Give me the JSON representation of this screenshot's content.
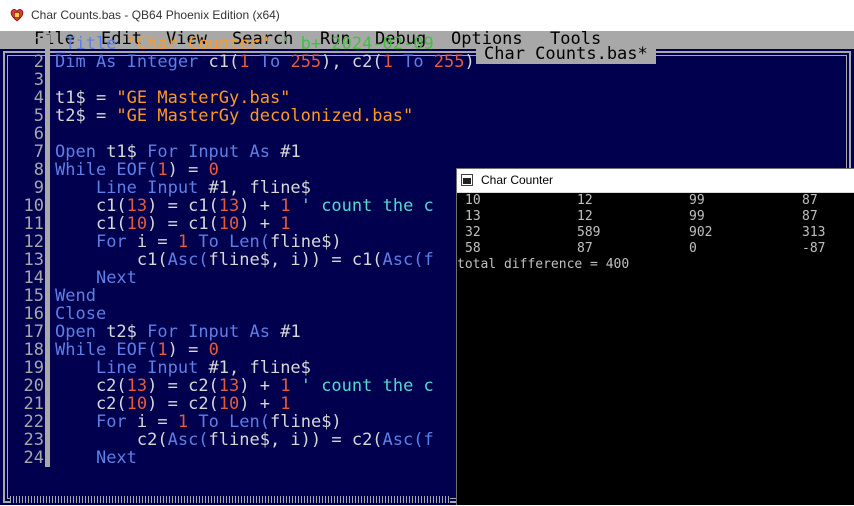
{
  "window": {
    "title": "Char Counts.bas - QB64 Phoenix Edition (x64)",
    "icon": "qb64-icon"
  },
  "menu": [
    "File",
    "Edit",
    "View",
    "Search",
    "Run",
    "Debug",
    "Options",
    "Tools"
  ],
  "editor": {
    "tab_label": "Char Counts.bas*",
    "lines": [
      {
        "num": "1",
        "tokens": [
          {
            "t": "_Title ",
            "c": "k"
          },
          {
            "t": "\"Char Counter\"",
            "c": "s"
          },
          {
            "t": " ' b+ 2024-02-09",
            "c": "m"
          }
        ]
      },
      {
        "num": "2",
        "tokens": [
          {
            "t": "Dim As Integer ",
            "c": "k"
          },
          {
            "t": "c1(",
            "c": "d"
          },
          {
            "t": "1",
            "c": "n"
          },
          {
            "t": " To ",
            "c": "k"
          },
          {
            "t": "255",
            "c": "n"
          },
          {
            "t": "), c2(",
            "c": "d"
          },
          {
            "t": "1",
            "c": "n"
          },
          {
            "t": " To ",
            "c": "k"
          },
          {
            "t": "255",
            "c": "n"
          },
          {
            "t": ")",
            "c": "d"
          }
        ]
      },
      {
        "num": "3",
        "tokens": []
      },
      {
        "num": "4",
        "tokens": [
          {
            "t": "t1$ = ",
            "c": "d"
          },
          {
            "t": "\"GE MasterGy.bas\"",
            "c": "s"
          }
        ]
      },
      {
        "num": "5",
        "tokens": [
          {
            "t": "t2$ = ",
            "c": "d"
          },
          {
            "t": "\"GE MasterGy decolonized.bas\"",
            "c": "s"
          }
        ]
      },
      {
        "num": "6",
        "tokens": []
      },
      {
        "num": "7",
        "tokens": [
          {
            "t": "Open ",
            "c": "k"
          },
          {
            "t": "t1$ ",
            "c": "d"
          },
          {
            "t": "For Input As ",
            "c": "k"
          },
          {
            "t": "#1",
            "c": "d"
          }
        ]
      },
      {
        "num": "8",
        "tokens": [
          {
            "t": "While EOF(",
            "c": "k"
          },
          {
            "t": "1",
            "c": "n"
          },
          {
            "t": ") = ",
            "c": "d"
          },
          {
            "t": "0",
            "c": "n"
          }
        ]
      },
      {
        "num": "9",
        "tokens": [
          {
            "t": "    ",
            "c": "d"
          },
          {
            "t": "Line Input ",
            "c": "k"
          },
          {
            "t": "#1, fline$",
            "c": "d"
          }
        ]
      },
      {
        "num": "10",
        "tokens": [
          {
            "t": "    c1(",
            "c": "d"
          },
          {
            "t": "13",
            "c": "n"
          },
          {
            "t": ") = c1(",
            "c": "d"
          },
          {
            "t": "13",
            "c": "n"
          },
          {
            "t": ") + ",
            "c": "d"
          },
          {
            "t": "1",
            "c": "n"
          },
          {
            "t": " ' count the c",
            "c": "c"
          }
        ]
      },
      {
        "num": "11",
        "tokens": [
          {
            "t": "    c1(",
            "c": "d"
          },
          {
            "t": "10",
            "c": "n"
          },
          {
            "t": ") = c1(",
            "c": "d"
          },
          {
            "t": "10",
            "c": "n"
          },
          {
            "t": ") + ",
            "c": "d"
          },
          {
            "t": "1",
            "c": "n"
          }
        ]
      },
      {
        "num": "12",
        "tokens": [
          {
            "t": "    ",
            "c": "d"
          },
          {
            "t": "For ",
            "c": "k"
          },
          {
            "t": "i = ",
            "c": "d"
          },
          {
            "t": "1",
            "c": "n"
          },
          {
            "t": " To ",
            "c": "k"
          },
          {
            "t": "Len(",
            "c": "k"
          },
          {
            "t": "fline$)",
            "c": "d"
          }
        ]
      },
      {
        "num": "13",
        "tokens": [
          {
            "t": "        c1(",
            "c": "d"
          },
          {
            "t": "Asc(",
            "c": "k"
          },
          {
            "t": "fline$, i)) = c1(",
            "c": "d"
          },
          {
            "t": "Asc(f",
            "c": "k"
          }
        ]
      },
      {
        "num": "14",
        "tokens": [
          {
            "t": "    ",
            "c": "d"
          },
          {
            "t": "Next",
            "c": "k"
          }
        ]
      },
      {
        "num": "15",
        "tokens": [
          {
            "t": "Wend",
            "c": "k"
          }
        ]
      },
      {
        "num": "16",
        "tokens": [
          {
            "t": "Close",
            "c": "k"
          }
        ]
      },
      {
        "num": "17",
        "tokens": [
          {
            "t": "Open ",
            "c": "k"
          },
          {
            "t": "t2$ ",
            "c": "d"
          },
          {
            "t": "For Input As ",
            "c": "k"
          },
          {
            "t": "#1",
            "c": "d"
          }
        ]
      },
      {
        "num": "18",
        "tokens": [
          {
            "t": "While EOF(",
            "c": "k"
          },
          {
            "t": "1",
            "c": "n"
          },
          {
            "t": ") = ",
            "c": "d"
          },
          {
            "t": "0",
            "c": "n"
          }
        ]
      },
      {
        "num": "19",
        "tokens": [
          {
            "t": "    ",
            "c": "d"
          },
          {
            "t": "Line Input ",
            "c": "k"
          },
          {
            "t": "#1, fline$",
            "c": "d"
          }
        ]
      },
      {
        "num": "20",
        "tokens": [
          {
            "t": "    c2(",
            "c": "d"
          },
          {
            "t": "13",
            "c": "n"
          },
          {
            "t": ") = c2(",
            "c": "d"
          },
          {
            "t": "13",
            "c": "n"
          },
          {
            "t": ") + ",
            "c": "d"
          },
          {
            "t": "1",
            "c": "n"
          },
          {
            "t": " ' count the c",
            "c": "c"
          }
        ]
      },
      {
        "num": "21",
        "tokens": [
          {
            "t": "    c2(",
            "c": "d"
          },
          {
            "t": "10",
            "c": "n"
          },
          {
            "t": ") = c2(",
            "c": "d"
          },
          {
            "t": "10",
            "c": "n"
          },
          {
            "t": ") + ",
            "c": "d"
          },
          {
            "t": "1",
            "c": "n"
          }
        ]
      },
      {
        "num": "22",
        "tokens": [
          {
            "t": "    ",
            "c": "d"
          },
          {
            "t": "For ",
            "c": "k"
          },
          {
            "t": "i = ",
            "c": "d"
          },
          {
            "t": "1",
            "c": "n"
          },
          {
            "t": " To ",
            "c": "k"
          },
          {
            "t": "Len(",
            "c": "k"
          },
          {
            "t": "fline$)",
            "c": "d"
          }
        ]
      },
      {
        "num": "23",
        "tokens": [
          {
            "t": "        c2(",
            "c": "d"
          },
          {
            "t": "Asc(",
            "c": "k"
          },
          {
            "t": "fline$, i)) = c2(",
            "c": "d"
          },
          {
            "t": "Asc(f",
            "c": "k"
          }
        ]
      },
      {
        "num": "24",
        "tokens": [
          {
            "t": "    ",
            "c": "d"
          },
          {
            "t": "Next",
            "c": "k"
          }
        ]
      }
    ]
  },
  "console": {
    "title": "Char Counter",
    "rows": [
      [
        "10",
        "12",
        "99",
        "87"
      ],
      [
        "13",
        "12",
        "99",
        "87"
      ],
      [
        "32",
        "589",
        "902",
        "313"
      ],
      [
        "58",
        "87",
        "0",
        "-87"
      ]
    ],
    "summary": "total difference = 400"
  }
}
